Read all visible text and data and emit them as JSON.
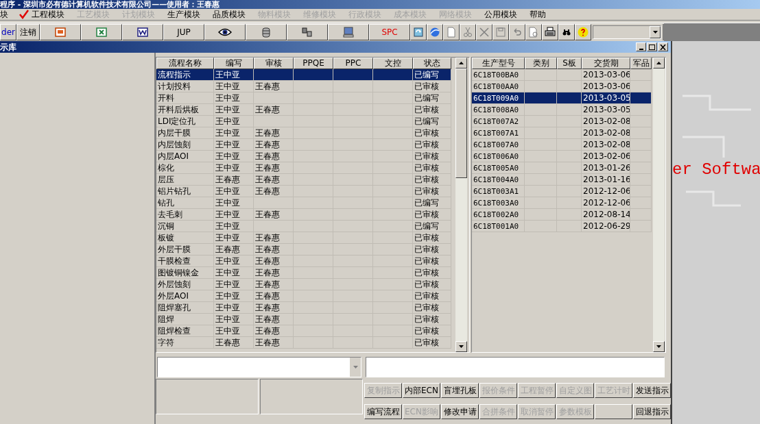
{
  "app_title": "程序 - 深圳市必有德计算机软件技术有限公司——使用者：王春惠",
  "menu": [
    {
      "label": "块",
      "checked": false,
      "disabled": false
    },
    {
      "label": "工程模块",
      "checked": true,
      "disabled": false
    },
    {
      "label": "工艺模块",
      "checked": false,
      "disabled": true
    },
    {
      "label": "计划模块",
      "checked": false,
      "disabled": true
    },
    {
      "label": "生产模块",
      "checked": false,
      "disabled": false
    },
    {
      "label": "品质模块",
      "checked": false,
      "disabled": false
    },
    {
      "label": "物料模块",
      "checked": false,
      "disabled": true
    },
    {
      "label": "维修模块",
      "checked": false,
      "disabled": true
    },
    {
      "label": "行政模块",
      "checked": false,
      "disabled": true
    },
    {
      "label": "成本模块",
      "checked": false,
      "disabled": true
    },
    {
      "label": "网络模块",
      "checked": false,
      "disabled": true
    },
    {
      "label": "公用模块",
      "checked": false,
      "disabled": false
    },
    {
      "label": "帮助",
      "checked": false,
      "disabled": false
    }
  ],
  "toolbar": [
    {
      "kind": "text",
      "label": "der",
      "color": "#0000c0"
    },
    {
      "kind": "text",
      "label": "注销",
      "color": "#000000"
    },
    {
      "kind": "icon"
    },
    {
      "kind": "icon"
    },
    {
      "kind": "icon"
    },
    {
      "kind": "text",
      "label": "JUP",
      "color": "#000000"
    },
    {
      "kind": "icon"
    },
    {
      "kind": "icon"
    },
    {
      "kind": "icon"
    },
    {
      "kind": "icon"
    },
    {
      "kind": "text",
      "label": "SPC",
      "color": "#e00000"
    },
    {
      "kind": "small"
    },
    {
      "kind": "small"
    },
    {
      "kind": "small"
    },
    {
      "kind": "small"
    },
    {
      "kind": "small"
    },
    {
      "kind": "small"
    },
    {
      "kind": "small"
    },
    {
      "kind": "small"
    },
    {
      "kind": "small"
    },
    {
      "kind": "small"
    },
    {
      "kind": "small"
    }
  ],
  "window": {
    "title": "示库"
  },
  "flow_table": {
    "columns": [
      "流程名称",
      "编写",
      "审核",
      "PPQE",
      "PPC",
      "文控",
      "状态"
    ],
    "rows": [
      {
        "selected": true,
        "cells": [
          "流程指示",
          "王中亚",
          "",
          "",
          "",
          "",
          "已编写"
        ]
      },
      {
        "selected": false,
        "cells": [
          "计划投料",
          "王中亚",
          "王春惠",
          "",
          "",
          "",
          "已审核"
        ]
      },
      {
        "selected": false,
        "cells": [
          "开料",
          "王中亚",
          "",
          "",
          "",
          "",
          "已编写"
        ]
      },
      {
        "selected": false,
        "cells": [
          "开料后烘板",
          "王中亚",
          "王春惠",
          "",
          "",
          "",
          "已审核"
        ]
      },
      {
        "selected": false,
        "cells": [
          "LDI定位孔",
          "王中亚",
          "",
          "",
          "",
          "",
          "已编写"
        ]
      },
      {
        "selected": false,
        "cells": [
          "内层干膜",
          "王中亚",
          "王春惠",
          "",
          "",
          "",
          "已审核"
        ]
      },
      {
        "selected": false,
        "cells": [
          "内层蚀刻",
          "王中亚",
          "王春惠",
          "",
          "",
          "",
          "已审核"
        ]
      },
      {
        "selected": false,
        "cells": [
          "内层AOI",
          "王中亚",
          "王春惠",
          "",
          "",
          "",
          "已审核"
        ]
      },
      {
        "selected": false,
        "cells": [
          "棕化",
          "王中亚",
          "王春惠",
          "",
          "",
          "",
          "已审核"
        ]
      },
      {
        "selected": false,
        "cells": [
          "层压",
          "王春惠",
          "王春惠",
          "",
          "",
          "",
          "已审核"
        ]
      },
      {
        "selected": false,
        "cells": [
          "铝片钻孔",
          "王中亚",
          "王春惠",
          "",
          "",
          "",
          "已审核"
        ]
      },
      {
        "selected": false,
        "cells": [
          "钻孔",
          "王中亚",
          "",
          "",
          "",
          "",
          "已编写"
        ]
      },
      {
        "selected": false,
        "cells": [
          "去毛刺",
          "王中亚",
          "王春惠",
          "",
          "",
          "",
          "已审核"
        ]
      },
      {
        "selected": false,
        "cells": [
          "沉铜",
          "王中亚",
          "",
          "",
          "",
          "",
          "已编写"
        ]
      },
      {
        "selected": false,
        "cells": [
          "板镀",
          "王中亚",
          "王春惠",
          "",
          "",
          "",
          "已审核"
        ]
      },
      {
        "selected": false,
        "cells": [
          "外层干膜",
          "王春惠",
          "王春惠",
          "",
          "",
          "",
          "已审核"
        ]
      },
      {
        "selected": false,
        "cells": [
          "干膜检查",
          "王中亚",
          "王春惠",
          "",
          "",
          "",
          "已审核"
        ]
      },
      {
        "selected": false,
        "cells": [
          "图镀铜镍金",
          "王中亚",
          "王春惠",
          "",
          "",
          "",
          "已审核"
        ]
      },
      {
        "selected": false,
        "cells": [
          "外层蚀刻",
          "王中亚",
          "王春惠",
          "",
          "",
          "",
          "已审核"
        ]
      },
      {
        "selected": false,
        "cells": [
          "外层AOI",
          "王中亚",
          "王春惠",
          "",
          "",
          "",
          "已审核"
        ]
      },
      {
        "selected": false,
        "cells": [
          "阻焊塞孔",
          "王中亚",
          "王春惠",
          "",
          "",
          "",
          "已审核"
        ]
      },
      {
        "selected": false,
        "cells": [
          "阻焊",
          "王中亚",
          "王春惠",
          "",
          "",
          "",
          "已审核"
        ]
      },
      {
        "selected": false,
        "cells": [
          "阻焊检查",
          "王中亚",
          "王春惠",
          "",
          "",
          "",
          "已审核"
        ]
      },
      {
        "selected": false,
        "cells": [
          "字符",
          "王春惠",
          "王春惠",
          "",
          "",
          "",
          "已审核"
        ]
      }
    ]
  },
  "model_table": {
    "columns": [
      "生产型号",
      "类别",
      "S板",
      "交货期",
      "军品"
    ],
    "rows": [
      {
        "selected": false,
        "cells": [
          "6C18T00BA0",
          "",
          "",
          "2013-03-06",
          ""
        ]
      },
      {
        "selected": false,
        "cells": [
          "6C18T00AA0",
          "",
          "",
          "2013-03-06",
          ""
        ]
      },
      {
        "selected": true,
        "cells": [
          "6C18T009A0",
          "",
          "",
          "2013-03-05",
          ""
        ]
      },
      {
        "selected": false,
        "cells": [
          "6C18T008A0",
          "",
          "",
          "2013-03-05",
          ""
        ]
      },
      {
        "selected": false,
        "cells": [
          "6C18T007A2",
          "",
          "",
          "2013-02-08",
          ""
        ]
      },
      {
        "selected": false,
        "cells": [
          "6C18T007A1",
          "",
          "",
          "2013-02-08",
          ""
        ]
      },
      {
        "selected": false,
        "cells": [
          "6C18T007A0",
          "",
          "",
          "2013-02-08",
          ""
        ]
      },
      {
        "selected": false,
        "cells": [
          "6C18T006A0",
          "",
          "",
          "2013-02-06",
          ""
        ]
      },
      {
        "selected": false,
        "cells": [
          "6C18T005A0",
          "",
          "",
          "2013-01-26",
          ""
        ]
      },
      {
        "selected": false,
        "cells": [
          "6C18T004A0",
          "",
          "",
          "2013-01-16",
          ""
        ]
      },
      {
        "selected": false,
        "cells": [
          "6C18T003A1",
          "",
          "",
          "2012-12-06",
          ""
        ]
      },
      {
        "selected": false,
        "cells": [
          "6C18T003A0",
          "",
          "",
          "2012-12-06",
          ""
        ]
      },
      {
        "selected": false,
        "cells": [
          "6C18T002A0",
          "",
          "",
          "2012-08-14",
          ""
        ]
      },
      {
        "selected": false,
        "cells": [
          "6C18T001A0",
          "",
          "",
          "2012-06-29",
          ""
        ]
      }
    ]
  },
  "background_text": "er Softwa",
  "action_buttons": [
    {
      "kind": "button",
      "label": "复制指示",
      "disabled": true
    },
    {
      "kind": "button",
      "label": "内部ECN",
      "disabled": false
    },
    {
      "kind": "button",
      "label": "盲埋孔板",
      "disabled": false
    },
    {
      "kind": "button",
      "label": "报价条件",
      "disabled": true
    },
    {
      "kind": "button",
      "label": "工程暂停",
      "disabled": true
    },
    {
      "kind": "button",
      "label": "自定义图",
      "disabled": true
    },
    {
      "kind": "button",
      "label": "工艺计时",
      "disabled": true
    },
    {
      "kind": "button",
      "label": "发送指示",
      "disabled": false
    },
    {
      "kind": "button",
      "label": "编写流程",
      "disabled": false
    },
    {
      "kind": "button",
      "label": "ECN影响",
      "disabled": true
    },
    {
      "kind": "button",
      "label": "修改申请",
      "disabled": false
    },
    {
      "kind": "button",
      "label": "合拼条件",
      "disabled": true
    },
    {
      "kind": "button",
      "label": "取消暂停",
      "disabled": true
    },
    {
      "kind": "button",
      "label": "参数模板",
      "disabled": true
    },
    {
      "kind": "blank"
    },
    {
      "kind": "button",
      "label": "回退指示",
      "disabled": false
    }
  ]
}
